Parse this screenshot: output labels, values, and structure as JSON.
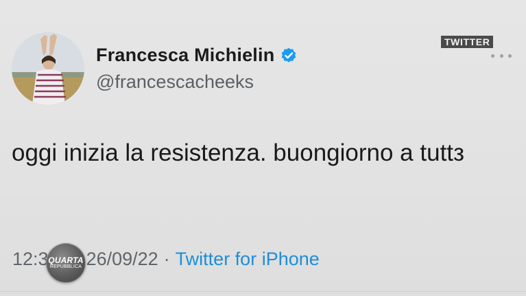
{
  "badge": {
    "label": "TWITTER"
  },
  "tweet": {
    "author": {
      "display_name": "Francesca Michielin",
      "handle": "@francescacheeks",
      "verified": true
    },
    "text": "oggi inizia la resistenza. buongiorno a tuttз",
    "time_visible": "12:3",
    "date_visible": "26/09/22",
    "separator": "·",
    "client": "Twitter for iPhone"
  },
  "overlay_logo": {
    "line1": "QUARTA",
    "line2": "REPUBBLICA"
  },
  "icons": {
    "verified": "verified-badge-icon",
    "more": "more-options-icon"
  },
  "colors": {
    "background": "#e3e3e3",
    "accent": "#1d8ed8",
    "verified": "#1d9bf0",
    "badge_bg": "#4a4a4a",
    "secondary_text": "#5f656b"
  }
}
